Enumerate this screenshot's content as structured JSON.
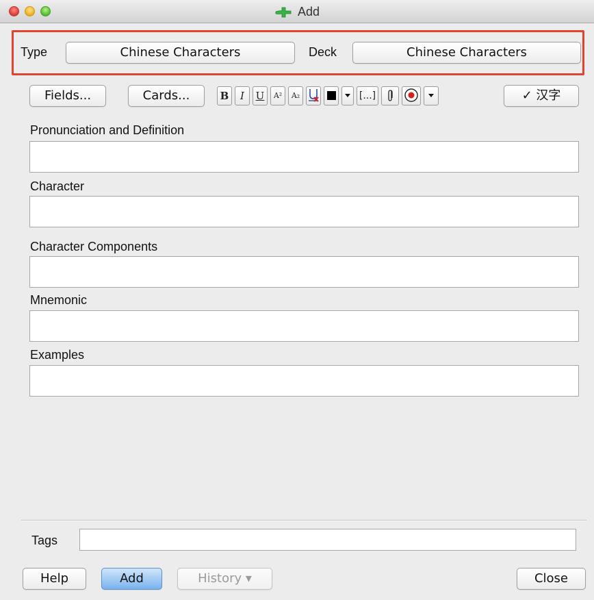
{
  "window": {
    "title": "Add"
  },
  "note_type": {
    "label": "Type",
    "value": "Chinese Characters"
  },
  "deck": {
    "label": "Deck",
    "value": "Chinese Characters"
  },
  "toolbar": {
    "fields_label": "Fields...",
    "cards_label": "Cards...",
    "bold_label": "B",
    "italic_label": "I",
    "underline_label": "U",
    "superscript_label": "A²",
    "subscript_label": "A₂",
    "cloze_label": "[...]",
    "hanzi_label": "✓ 汉字"
  },
  "fields": [
    {
      "label": "Pronunciation and Definition",
      "value": ""
    },
    {
      "label": "Character",
      "value": ""
    },
    {
      "label": "Character Components",
      "value": ""
    },
    {
      "label": "Mnemonic",
      "value": ""
    },
    {
      "label": "Examples",
      "value": ""
    }
  ],
  "tags": {
    "label": "Tags",
    "value": ""
  },
  "buttons": {
    "help": "Help",
    "add": "Add",
    "history": "History ▾",
    "close": "Close"
  },
  "colors": {
    "highlight_border": "#e0442f",
    "primary_button": "#79b3ee",
    "plus_icon": "#37b34a"
  }
}
